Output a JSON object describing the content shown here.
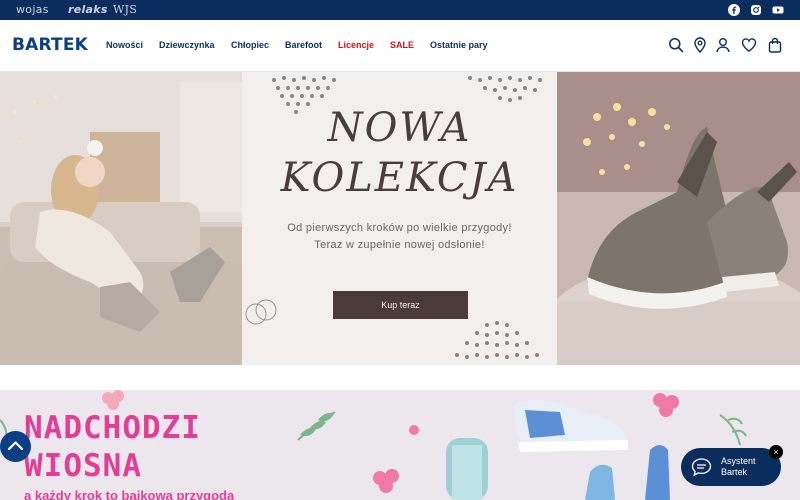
{
  "topbar": {
    "brands": [
      "wojas",
      "relaks",
      "WJS"
    ],
    "social": [
      "facebook-icon",
      "instagram-icon",
      "youtube-icon"
    ]
  },
  "header": {
    "logo": "BARTEK",
    "nav": [
      "Nowości",
      "Dziewczynka",
      "Chłopiec",
      "Barefoot",
      "Licencje",
      "SALE",
      "Ostatnie pary"
    ],
    "icons": [
      "search-icon",
      "location-icon",
      "account-icon",
      "wishlist-icon",
      "cart-icon"
    ]
  },
  "hero": {
    "title_line1": "NOWA",
    "title_line2": "KOLEKCJA",
    "subtitle_line1": "Od pierwszych kroków po wielkie przygody!",
    "subtitle_line2": "Teraz w zupełnie nowej odsłonie!",
    "cta": "Kup teraz"
  },
  "banner2": {
    "line1": "NADCHODZI",
    "line2": "WIOSNA",
    "line3": "a każdy krok to bajkowa przygoda"
  },
  "chat": {
    "label_line1": "Asystent",
    "label_line2": "Bartek",
    "close": "×"
  },
  "colors": {
    "navy": "#0b2d5e",
    "sale_red": "#d0111b",
    "pink": "#e43d95",
    "hero_bg": "#f2efec"
  }
}
